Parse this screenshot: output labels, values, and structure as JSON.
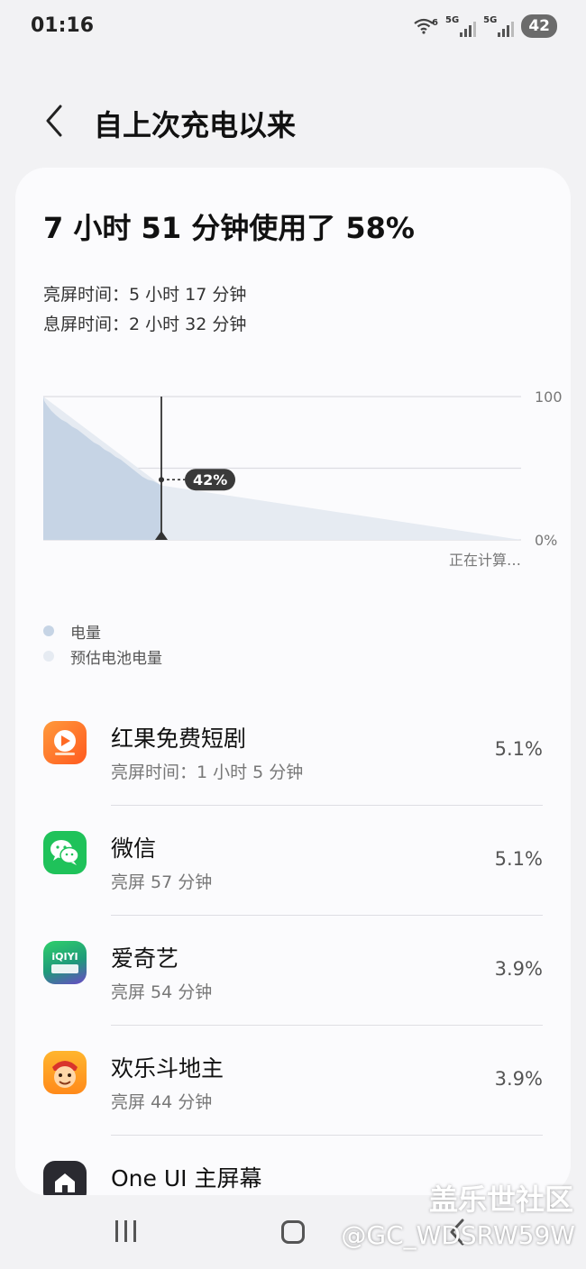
{
  "status": {
    "time": "01:16",
    "signal1": "5G",
    "signal2": "5G",
    "wifi_label": "6",
    "battery": "42"
  },
  "header": {
    "title": "自上次充电以来"
  },
  "summary": {
    "headline": "7 小时 51 分钟使用了 58%",
    "screen_on": "亮屏时间：5 小时 17 分钟",
    "screen_off": "息屏时间：2 小时 32 分钟"
  },
  "chart_data": {
    "type": "area",
    "start_badge": "100",
    "y_tick_labels": [
      "100",
      "0%"
    ],
    "ylim": [
      0,
      100
    ],
    "marker_label": "42%",
    "marker_value": 42,
    "footer": "正在计算…",
    "series": [
      {
        "name": "电量",
        "color": "#c6d4e5",
        "x": [
          0,
          1,
          4,
          9,
          14,
          20,
          26,
          32,
          38,
          44,
          50,
          56,
          62,
          68,
          74,
          80,
          86,
          92,
          98,
          104,
          110,
          116,
          122,
          128,
          131
        ],
        "values": [
          100,
          97,
          94,
          90,
          87,
          84,
          82,
          79,
          77,
          74,
          71,
          68,
          66,
          63,
          61,
          58,
          56,
          53,
          50,
          47,
          44,
          42,
          41,
          39,
          38
        ]
      },
      {
        "name": "预估电池电量",
        "color": "#e6ebf2",
        "x": [
          0,
          131,
          530
        ],
        "values": [
          100,
          38,
          0
        ]
      }
    ]
  },
  "legend": [
    {
      "label": "电量",
      "color": "#c6d4e5"
    },
    {
      "label": "预估电池电量",
      "color": "#e6ebf2"
    }
  ],
  "apps": [
    {
      "name": "红果免费短剧",
      "sub": "亮屏时间：1 小时 5 分钟",
      "pct": "5.1%",
      "icon": "hongguo-icon"
    },
    {
      "name": "微信",
      "sub": "亮屏 57 分钟",
      "pct": "5.1%",
      "icon": "wechat-icon"
    },
    {
      "name": "爱奇艺",
      "sub": "亮屏 54 分钟",
      "pct": "3.9%",
      "icon": "iqiyi-icon"
    },
    {
      "name": "欢乐斗地主",
      "sub": "亮屏 44 分钟",
      "pct": "3.9%",
      "icon": "doudizhu-icon"
    },
    {
      "name": "One UI 主屏幕",
      "sub": "",
      "pct": "",
      "icon": "oneui-home-icon"
    }
  ],
  "watermark": {
    "line1": "盖乐世社区",
    "line2": "@GC_WDSRW59W"
  }
}
